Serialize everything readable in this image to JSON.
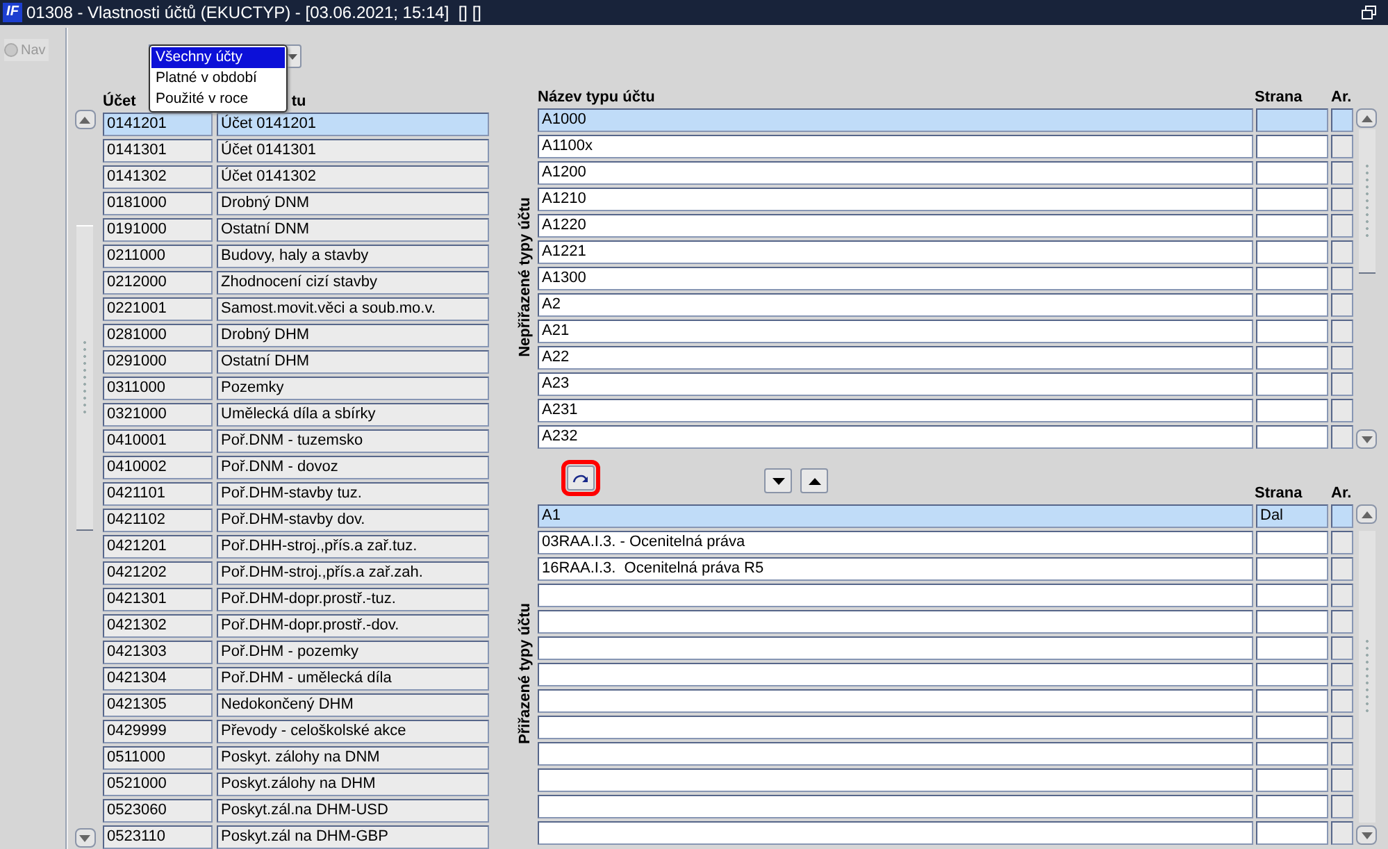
{
  "window": {
    "logo": "IF",
    "title": "01308 - Vlastnosti účtů (EKUCTYP) - [03.06.2021; 15:14]  [] []"
  },
  "nav": {
    "label": "Nav",
    "disabled": true
  },
  "filter": {
    "expanded": true,
    "options": [
      {
        "label": "Všechny účty",
        "selected": true
      },
      {
        "label": "Platné v období",
        "selected": false
      },
      {
        "label": "Použité v roce",
        "selected": false
      }
    ]
  },
  "accounts": {
    "columns": [
      "Účet",
      "tu"
    ],
    "rows": [
      {
        "code": "0141201",
        "name": "Účet 0141201",
        "selected": true
      },
      {
        "code": "0141301",
        "name": "Účet 0141301",
        "selected": false
      },
      {
        "code": "0141302",
        "name": "Účet 0141302",
        "selected": false
      },
      {
        "code": "0181000",
        "name": "Drobný DNM",
        "selected": false
      },
      {
        "code": "0191000",
        "name": "Ostatní DNM",
        "selected": false
      },
      {
        "code": "0211000",
        "name": "Budovy, haly a stavby",
        "selected": false
      },
      {
        "code": "0212000",
        "name": "Zhodnocení cizí stavby",
        "selected": false
      },
      {
        "code": "0221001",
        "name": "Samost.movit.věci a soub.mo.v.",
        "selected": false
      },
      {
        "code": "0281000",
        "name": "Drobný DHM",
        "selected": false
      },
      {
        "code": "0291000",
        "name": "Ostatní DHM",
        "selected": false
      },
      {
        "code": "0311000",
        "name": "Pozemky",
        "selected": false
      },
      {
        "code": "0321000",
        "name": "Umělecká díla a sbírky",
        "selected": false
      },
      {
        "code": "0410001",
        "name": "Poř.DNM - tuzemsko",
        "selected": false
      },
      {
        "code": "0410002",
        "name": "Poř.DNM - dovoz",
        "selected": false
      },
      {
        "code": "0421101",
        "name": "Poř.DHM-stavby tuz.",
        "selected": false
      },
      {
        "code": "0421102",
        "name": "Poř.DHM-stavby dov.",
        "selected": false
      },
      {
        "code": "0421201",
        "name": "Poř.DHH-stroj.,přís.a zař.tuz.",
        "selected": false
      },
      {
        "code": "0421202",
        "name": "Poř.DHM-stroj.,přís.a zař.zah.",
        "selected": false
      },
      {
        "code": "0421301",
        "name": "Poř.DHM-dopr.prostř.-tuz.",
        "selected": false
      },
      {
        "code": "0421302",
        "name": "Poř.DHM-dopr.prostř.-dov.",
        "selected": false
      },
      {
        "code": "0421303",
        "name": "Poř.DHM - pozemky",
        "selected": false
      },
      {
        "code": "0421304",
        "name": "Poř.DHM - umělecká díla",
        "selected": false
      },
      {
        "code": "0421305",
        "name": "Nedokončený DHM",
        "selected": false
      },
      {
        "code": "0429999",
        "name": "Převody - celoškolské akce",
        "selected": false
      },
      {
        "code": "0511000",
        "name": "Poskyt. zálohy na DNM",
        "selected": false
      },
      {
        "code": "0521000",
        "name": "Poskyt.zálohy na DHM",
        "selected": false
      },
      {
        "code": "0523060",
        "name": "Poskyt.zál.na DHM-USD",
        "selected": false
      },
      {
        "code": "0523110",
        "name": "Poskyt.zál na DHM-GBP",
        "selected": false
      }
    ]
  },
  "unassigned": {
    "title": "Nepřiřazené typy účtu",
    "columns": {
      "name": "Název typu účtu",
      "side": "Strana",
      "flag": "Ar."
    },
    "rows": [
      {
        "name": "A1000",
        "selected": true
      },
      {
        "name": "A1100x",
        "selected": false
      },
      {
        "name": "A1200",
        "selected": false
      },
      {
        "name": "A1210",
        "selected": false
      },
      {
        "name": "A1220",
        "selected": false
      },
      {
        "name": "A1221",
        "selected": false
      },
      {
        "name": "A1300",
        "selected": false
      },
      {
        "name": "A2",
        "selected": false
      },
      {
        "name": "A21",
        "selected": false
      },
      {
        "name": "A22",
        "selected": false
      },
      {
        "name": "A23",
        "selected": false
      },
      {
        "name": "A231",
        "selected": false
      },
      {
        "name": "A232",
        "selected": false
      }
    ]
  },
  "toolbar": [
    {
      "kind": "refresh",
      "highlighted": true
    },
    {
      "kind": "down",
      "highlighted": false
    },
    {
      "kind": "up",
      "highlighted": false
    }
  ],
  "assigned": {
    "title": "Přiřazené typy účtu",
    "columns": {
      "side": "Strana",
      "flag": "Ar."
    },
    "rows": [
      {
        "name": "A1",
        "side": "Dal",
        "selected": true
      },
      {
        "name": "03RAA.I.3. - Ocenitelná práva",
        "selected": false
      },
      {
        "name": "16RAA.I.3.  Ocenitelná práva R5",
        "selected": false
      },
      {
        "selected": false
      },
      {
        "selected": false
      },
      {
        "selected": false
      },
      {
        "selected": false
      },
      {
        "selected": false
      },
      {
        "selected": false
      },
      {
        "selected": false
      },
      {
        "selected": false
      },
      {
        "selected": false
      },
      {
        "selected": false
      }
    ]
  }
}
